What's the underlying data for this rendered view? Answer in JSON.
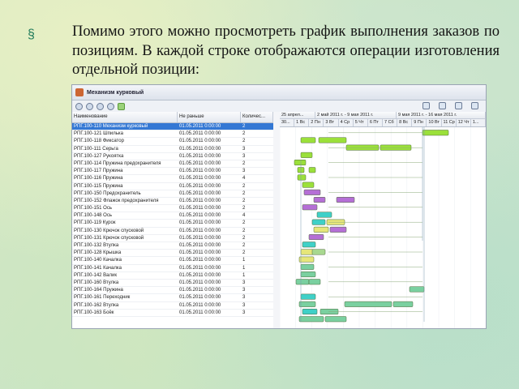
{
  "slide": {
    "paragraph": "Помимо этого можно просмотреть график выполнения заказов по позициям. В каждой строке отображаются операции изготовления отдельной позиции:"
  },
  "app": {
    "window_title": "Механизм курковый",
    "columns": [
      "Наименование",
      "Не раньше",
      "Количес..."
    ],
    "rows": [
      {
        "name": "РПГ.100-110 Механизм курковый",
        "date": "01.05.2011 0:00:00",
        "qty": "2"
      },
      {
        "name": "РПГ.100-121 Шпилька",
        "date": "01.05.2011 0:00:00",
        "qty": "2"
      },
      {
        "name": "РПГ.100-118 Фиксатор",
        "date": "01.05.2011 0:00:00",
        "qty": "2"
      },
      {
        "name": "РПГ.100-111 Серьга",
        "date": "01.05.2011 0:00:00",
        "qty": "3"
      },
      {
        "name": "РПГ.100-127 Рукоятка",
        "date": "01.05.2011 0:00:00",
        "qty": "3"
      },
      {
        "name": "РПГ.100-114 Пружина предохранителя",
        "date": "01.05.2011 0:00:00",
        "qty": "2"
      },
      {
        "name": "РПГ.100-117 Пружина",
        "date": "01.05.2011 0:00:00",
        "qty": "3"
      },
      {
        "name": "РПГ.100-116 Пружина",
        "date": "01.05.2011 0:00:00",
        "qty": "4"
      },
      {
        "name": "РПГ.100-115 Пружина",
        "date": "01.05.2011 0:00:00",
        "qty": "2"
      },
      {
        "name": "РПГ.100-150 Предохранитель",
        "date": "01.05.2011 0:00:00",
        "qty": "2"
      },
      {
        "name": "РПГ.100-152 Флажок предохранителя",
        "date": "01.05.2011 0:00:00",
        "qty": "2"
      },
      {
        "name": "РПГ.100-151 Ось",
        "date": "01.05.2011 0:00:00",
        "qty": "2"
      },
      {
        "name": "РПГ.100-148 Ось",
        "date": "01.05.2011 0:00:00",
        "qty": "4"
      },
      {
        "name": "РПГ.100-119 Курок",
        "date": "01.05.2011 0:00:00",
        "qty": "2"
      },
      {
        "name": "РПГ.100-130 Крючок спусковой",
        "date": "01.05.2011 0:00:00",
        "qty": "2"
      },
      {
        "name": "РПГ.100-131 Крючок спусковой",
        "date": "01.05.2011 0:00:00",
        "qty": "2"
      },
      {
        "name": "РПГ.100-132 Втулка",
        "date": "01.05.2011 0:00:00",
        "qty": "2"
      },
      {
        "name": "РПГ.100-128 Крышка",
        "date": "01.05.2011 0:00:00",
        "qty": "2"
      },
      {
        "name": "РПГ.100-140 Качалка",
        "date": "01.05.2011 0:00:00",
        "qty": "1"
      },
      {
        "name": "РПГ.100-141 Качалка",
        "date": "01.05.2011 0:00:00",
        "qty": "1"
      },
      {
        "name": "РПГ.100-142 Валик",
        "date": "01.05.2011 0:00:00",
        "qty": "1"
      },
      {
        "name": "РПГ.100-160 Втулка",
        "date": "01.05.2011 0:00:00",
        "qty": "3"
      },
      {
        "name": "РПГ.100-164 Пружина",
        "date": "01.05.2011 0:00:00",
        "qty": "3"
      },
      {
        "name": "РПГ.100-161 Переходник",
        "date": "01.05.2011 0:00:00",
        "qty": "3"
      },
      {
        "name": "РПГ.100-162 Втулка",
        "date": "01.05.2011 0:00:00",
        "qty": "3"
      },
      {
        "name": "РПГ.100-163 Боёк",
        "date": "01.05.2011 0:00:00",
        "qty": "3"
      }
    ],
    "gantt_weeks": [
      "25 апрел...",
      "2 май 2011 г. - 9 мая 2011 г.",
      "9 мая 2011 г. - 16 мая 2011 г."
    ],
    "gantt_days": [
      "30...",
      "1 Вс",
      "2 Пн",
      "3 Вт",
      "4 Ср",
      "5 Чт",
      "6 Пт",
      "7 Сб",
      "8 Вс",
      "9 Пн",
      "10 Вт",
      "11 Ср",
      "12 Чт",
      "1..."
    ],
    "bar_colors": [
      "#9be03a",
      "#b56fd6",
      "#3fd0c8",
      "#e6e67a",
      "#a8d890",
      "#7ad0a0"
    ]
  }
}
